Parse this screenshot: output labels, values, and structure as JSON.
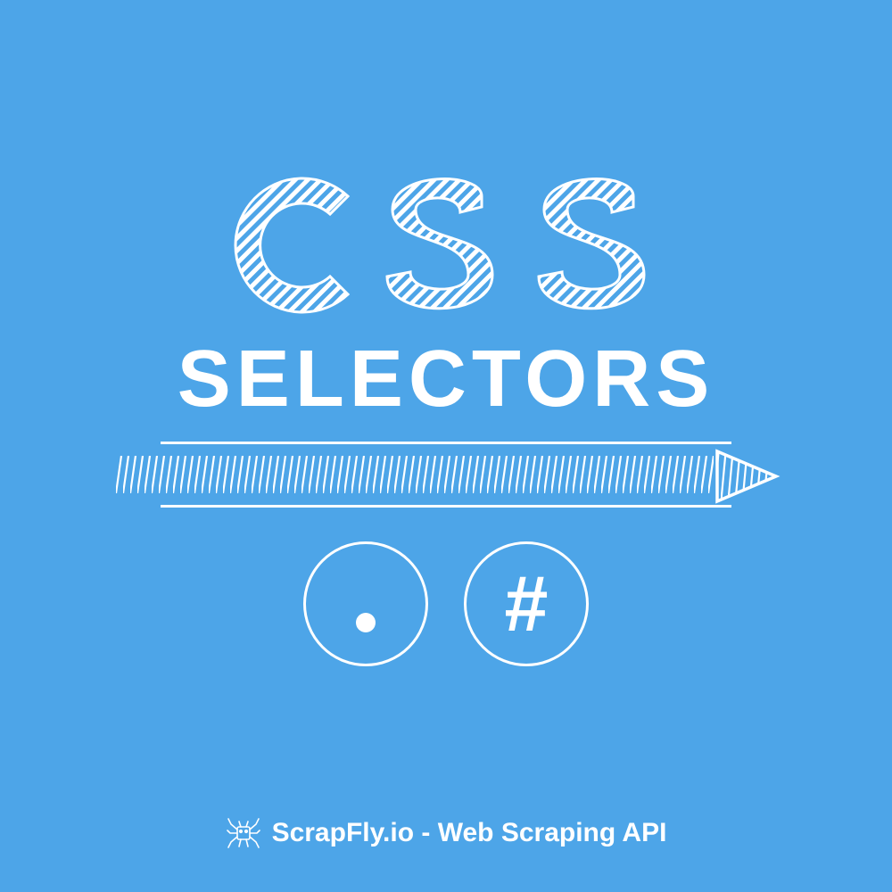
{
  "title": {
    "main": "CSS",
    "sub": "SELECTORS"
  },
  "symbols": {
    "class_selector": ".",
    "id_selector": "#"
  },
  "footer": {
    "text": "ScrapFly.io - Web Scraping API",
    "icon": "spider-icon"
  },
  "colors": {
    "background": "#4da5e8",
    "foreground": "#ffffff"
  }
}
